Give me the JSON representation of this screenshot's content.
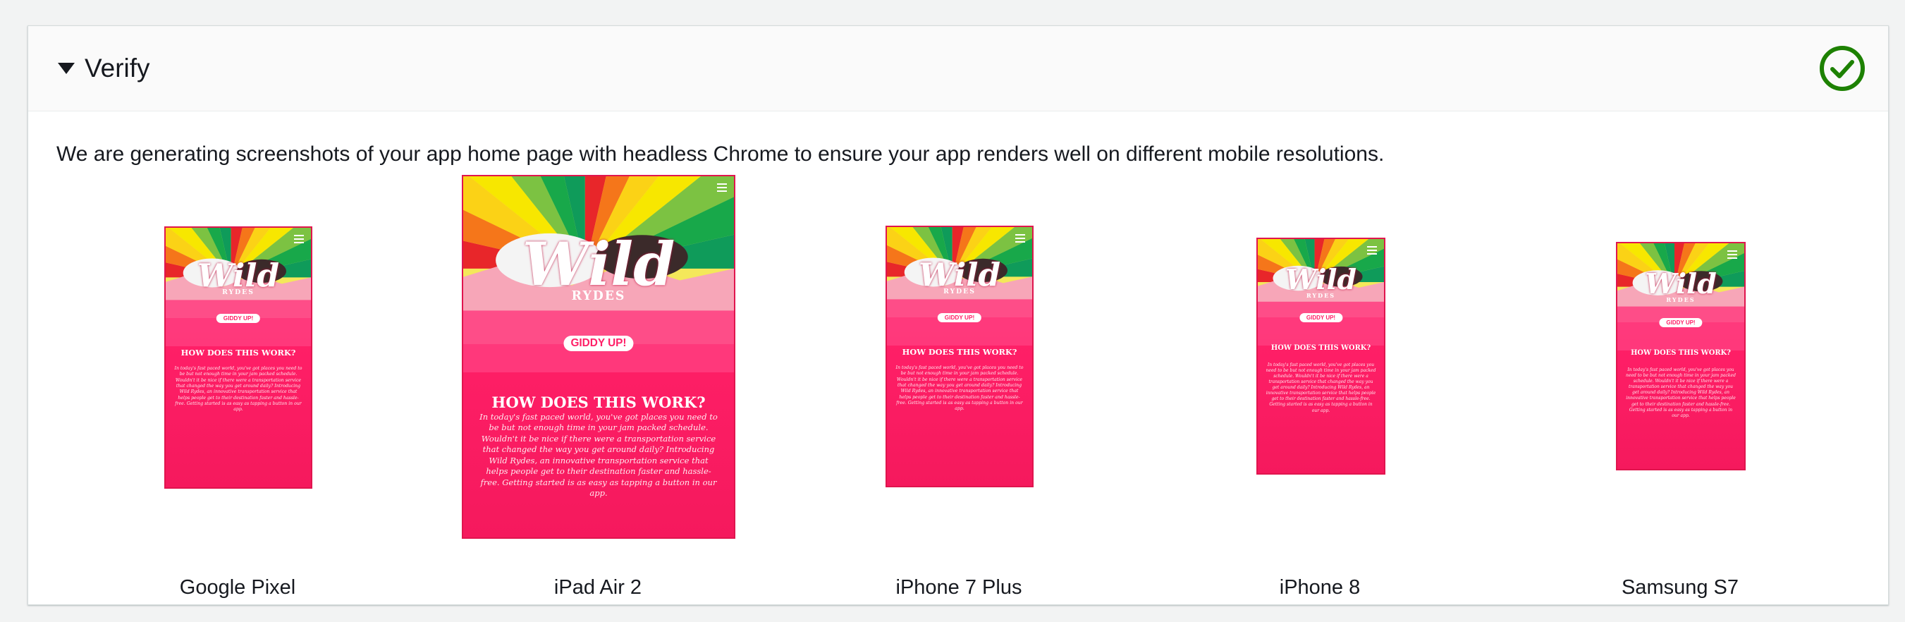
{
  "panel": {
    "title": "Verify",
    "status_icon": "success-check-icon",
    "accent_color": "#1d8102"
  },
  "description": "We are generating screenshots of your app home page with headless Chrome to ensure your app renders well on different mobile resolutions.",
  "devices": [
    {
      "label": "Google Pixel"
    },
    {
      "label": "iPad Air 2"
    },
    {
      "label": "iPhone 7 Plus"
    },
    {
      "label": "iPhone 8"
    },
    {
      "label": "Samsung S7"
    }
  ],
  "app_preview": {
    "logo_text": "Wild",
    "logo_subtext": "RYDES",
    "cta_label": "GIDDY UP!",
    "section_heading": "HOW DOES THIS WORK?",
    "body_text": "In today's fast paced world, you've got places you need to be but not enough time in your jam packed schedule. Wouldn't it be nice if there were a transportation service that changed the way you get around daily? Introducing Wild Rydes, an innovative transportation service that helps people get to their destination faster and hassle-free. Getting started is as easy as tapping a button in our app.",
    "brand_color": "#ff1f67"
  }
}
